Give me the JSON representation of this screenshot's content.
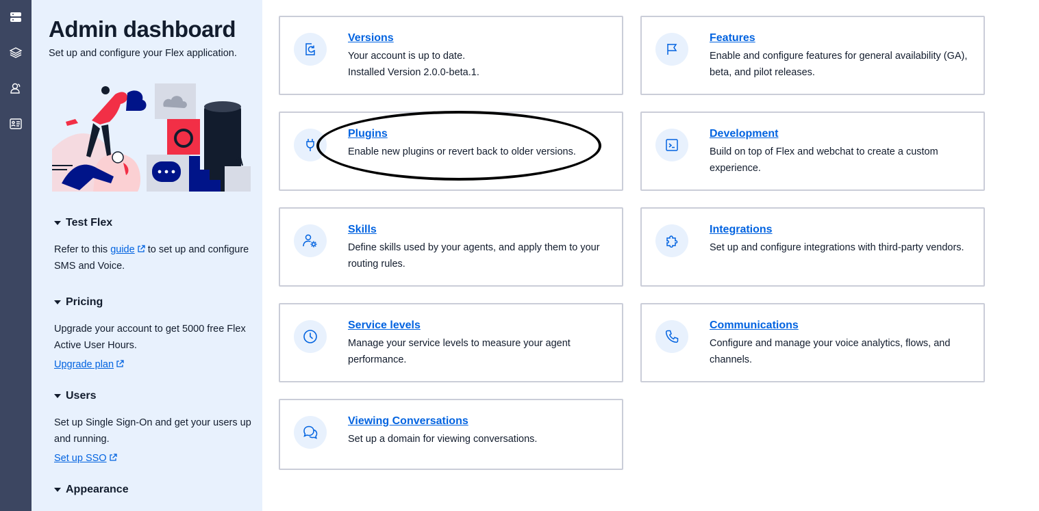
{
  "rail": {
    "items": [
      {
        "icon": "server-icon"
      },
      {
        "icon": "layers-icon"
      },
      {
        "icon": "users-icon"
      },
      {
        "icon": "admin-card-icon"
      }
    ]
  },
  "sidebar": {
    "title": "Admin dashboard",
    "subtitle": "Set up and configure your Flex application.",
    "sections": [
      {
        "heading": "Test Flex",
        "text_before": "Refer to this ",
        "link": "guide",
        "text_after": " to set up and configure SMS and Voice."
      },
      {
        "heading": "Pricing",
        "text": "Upgrade your account to get 5000 free Flex Active User Hours.",
        "link": "Upgrade plan"
      },
      {
        "heading": "Users",
        "text": "Set up Single Sign-On and get your users up and running.",
        "link": "Set up SSO"
      },
      {
        "heading": "Appearance"
      }
    ]
  },
  "cards": [
    {
      "title": "Versions",
      "desc": "Your account is up to date.",
      "desc2": "Installed Version 2.0.0-beta.1.",
      "icon": "refresh-icon"
    },
    {
      "title": "Features",
      "desc": "Enable and configure features for general availability (GA), beta, and pilot releases.",
      "icon": "flag-icon"
    },
    {
      "title": "Plugins",
      "desc": "Enable new plugins or revert back to older versions.",
      "icon": "plug-icon"
    },
    {
      "title": "Development",
      "desc": "Build on top of Flex and webchat to create a custom experience.",
      "icon": "terminal-icon"
    },
    {
      "title": "Skills",
      "desc": "Define skills used by your agents, and apply them to your routing rules.",
      "icon": "user-gear-icon"
    },
    {
      "title": "Integrations",
      "desc": "Set up and configure integrations with third-party vendors.",
      "icon": "puzzle-icon"
    },
    {
      "title": "Service levels",
      "desc": "Manage your service levels to measure your agent performance.",
      "icon": "clock-icon"
    },
    {
      "title": "Communications",
      "desc": "Configure and manage your voice analytics, flows, and channels.",
      "icon": "phone-icon"
    },
    {
      "title": "Viewing Conversations",
      "desc": "Set up a domain for viewing conversations.",
      "icon": "chat-bubbles-icon"
    }
  ],
  "colors": {
    "link": "#0263e0",
    "rail": "#3c4661",
    "panel": "#e8f1fd",
    "annotation": "#000000"
  }
}
